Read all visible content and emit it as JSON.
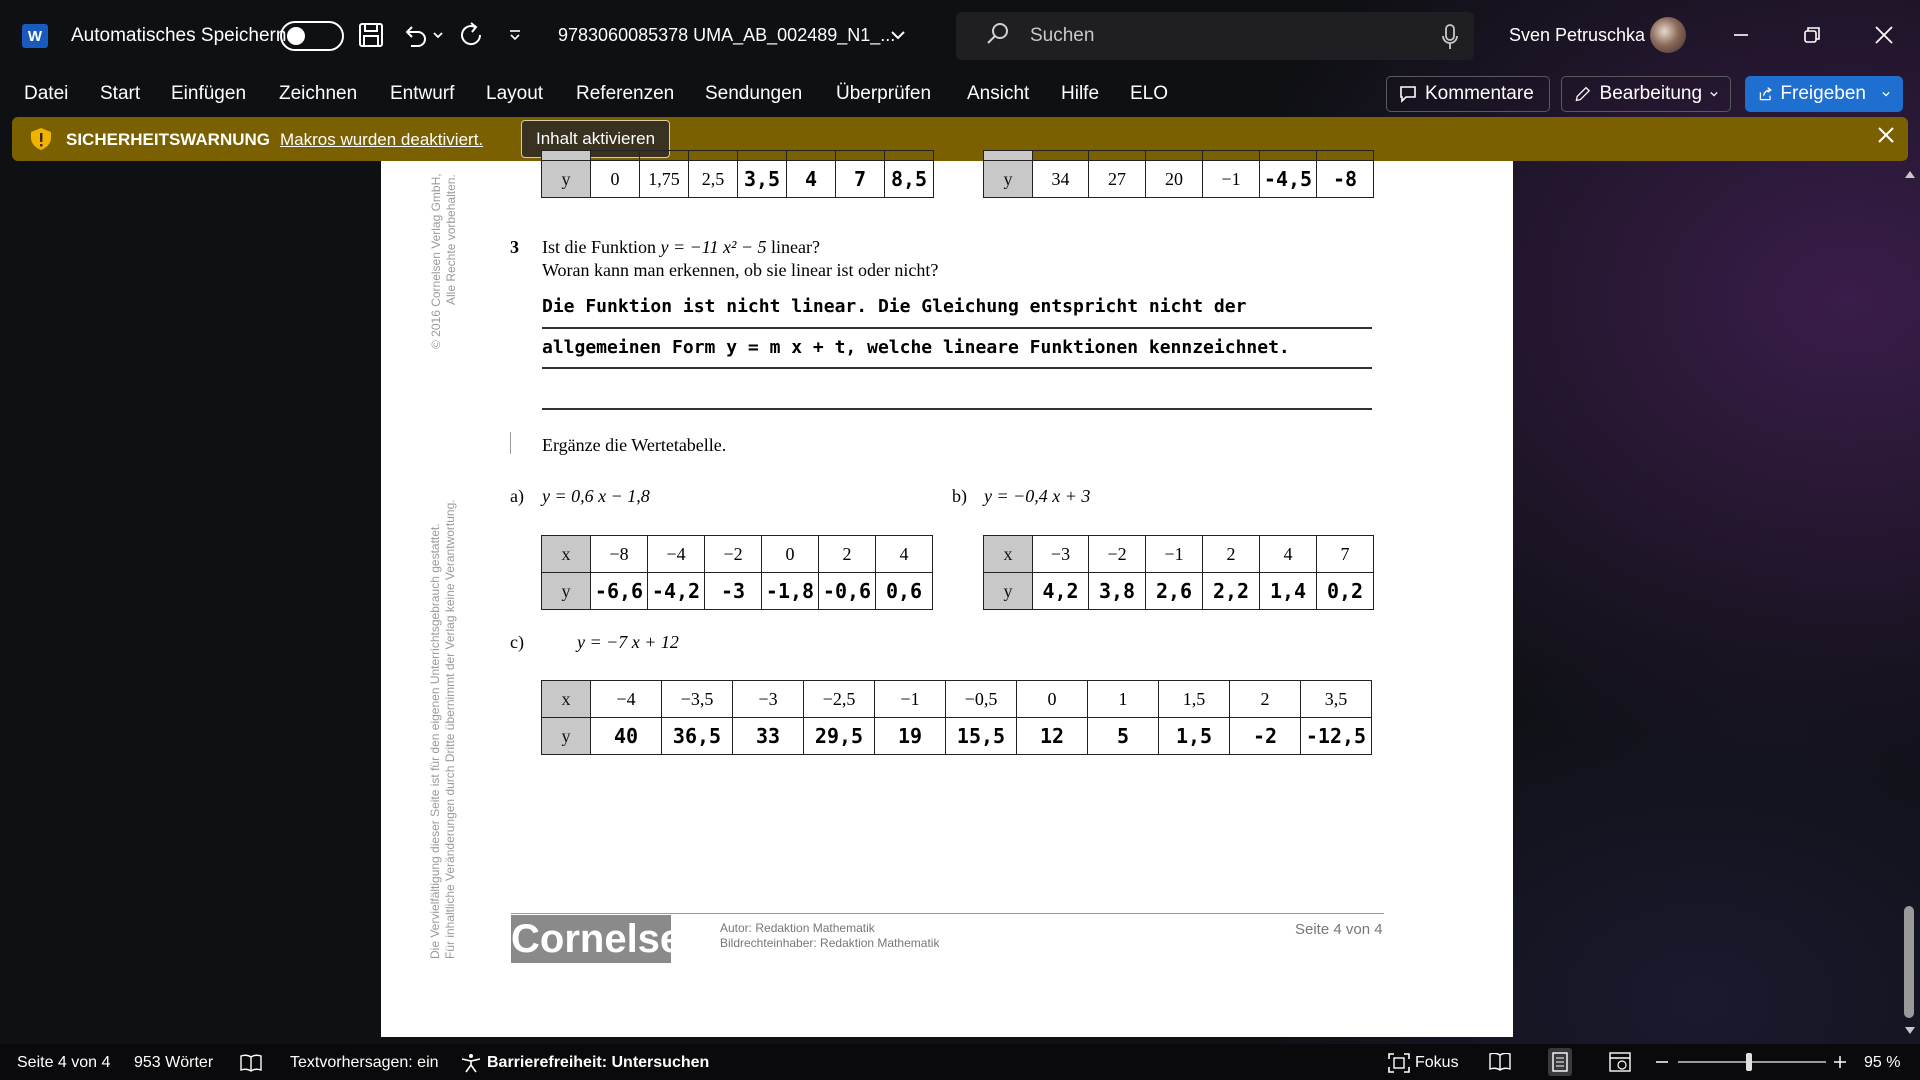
{
  "titlebar": {
    "autosave_label": "Automatisches Speichern",
    "doc_title": "9783060085378 UMA_AB_002489_N1_...",
    "search_placeholder": "Suchen",
    "user_name": "Sven Petruschka"
  },
  "menu": [
    "Datei",
    "Start",
    "Einfügen",
    "Zeichnen",
    "Entwurf",
    "Layout",
    "Referenzen",
    "Sendungen",
    "Überprüfen",
    "Ansicht",
    "Hilfe",
    "ELO"
  ],
  "ribbon_buttons": {
    "comments": "Kommentare",
    "editing": "Bearbeitung",
    "share": "Freigeben"
  },
  "security_bar": {
    "title": "SICHERHEITSWARNUNG",
    "message": "Makros wurden deaktiviert.",
    "button": "Inhalt aktivieren"
  },
  "document": {
    "side_copyright_1": "© 2016 Cornelsen Verlag GmbH,",
    "side_copyright_2": "Alle Rechte vorbehalten.",
    "side_notice_1": "Die Vervielfältigung dieser Seite ist für den eigenen Unterrichtsgebrauch gestattet.",
    "side_notice_2": "Für inhaltliche Veränderungen durch Dritte übernimmt der Verlag keine Verantwortung.",
    "top_table_left": {
      "label": "y",
      "values": [
        "0",
        "1,75",
        "2,5"
      ],
      "answers": [
        "3,5",
        "4",
        "7",
        "8,5"
      ]
    },
    "top_table_right": {
      "label": "y",
      "values": [
        "34",
        "27",
        "20",
        "−1"
      ],
      "answers": [
        "-4,5",
        "-8"
      ]
    },
    "task3": {
      "number": "3",
      "question_prefix": "Ist die Funktion ",
      "equation": "y = −11 x² − 5",
      "question_suffix": " linear?",
      "question_line2": "Woran kann man erkennen, ob sie linear ist oder nicht?",
      "answer_line1": "Die Funktion ist nicht linear. Die Gleichung entspricht nicht der",
      "answer_line2": "allgemeinen Form y = m x + t, welche lineare Funktionen kennzeichnet."
    },
    "task4": {
      "instruction": "Ergänze die Wertetabelle.",
      "a": {
        "label": "a)",
        "equation": "y = 0,6 x − 1,8",
        "x_label": "x",
        "y_label": "y",
        "x": [
          "−8",
          "−4",
          "−2",
          "0",
          "2",
          "4"
        ],
        "y": [
          "-6,6",
          "-4,2",
          "-3",
          "-1,8",
          "-0,6",
          "0,6"
        ]
      },
      "b": {
        "label": "b)",
        "equation": "y = −0,4 x + 3",
        "x_label": "x",
        "y_label": "y",
        "x": [
          "−3",
          "−2",
          "−1",
          "2",
          "4",
          "7"
        ],
        "y": [
          "4,2",
          "3,8",
          "2,6",
          "2,2",
          "1,4",
          "0,2"
        ]
      },
      "c": {
        "label": "c)",
        "equation": "y = −7 x + 12",
        "x_label": "x",
        "y_label": "y",
        "x": [
          "−4",
          "−3,5",
          "−3",
          "−2,5",
          "−1",
          "−0,5",
          "0",
          "1",
          "1,5",
          "2",
          "3,5"
        ],
        "y": [
          "40",
          "36,5",
          "33",
          "29,5",
          "19",
          "15,5",
          "12",
          "5",
          "1,5",
          "-2",
          "-12,5"
        ]
      }
    },
    "footer": {
      "logo": "Cornelsen",
      "author": "Autor: Redaktion Mathematik",
      "rights": "Bildrechteinhaber: Redaktion Mathematik",
      "page": "Seite 4 von 4"
    }
  },
  "statusbar": {
    "page": "Seite 4 von 4",
    "words": "953 Wörter",
    "predictions": "Textvorhersagen: ein",
    "accessibility": "Barrierefreiheit: Untersuchen",
    "focus": "Fokus",
    "zoom": "95 %"
  },
  "colors": {
    "security_bar": "#7a6000",
    "share_button": "#1e6fd0",
    "table_header": "#c8c8c8"
  }
}
